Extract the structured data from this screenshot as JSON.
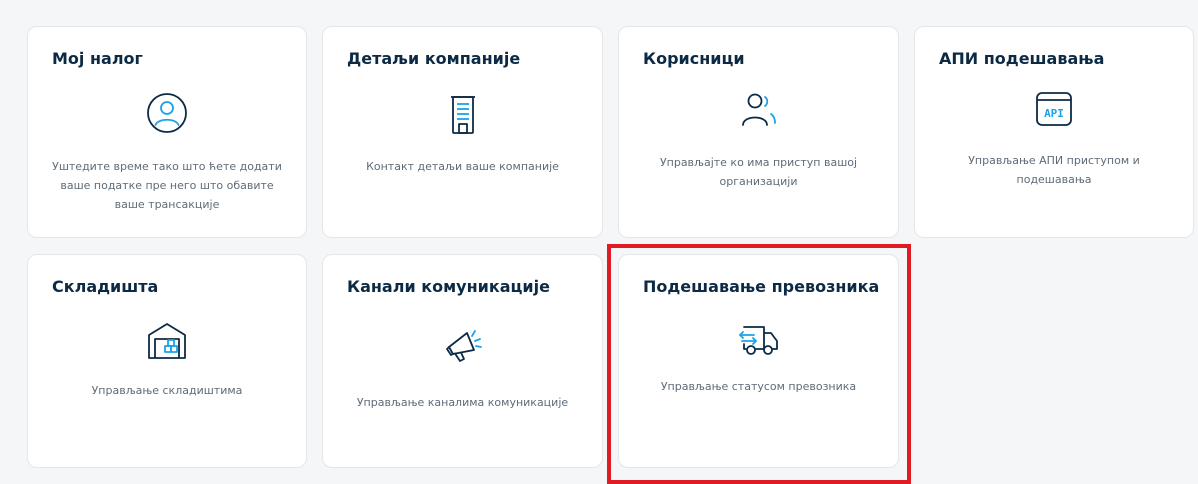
{
  "colors": {
    "page_background": "#f5f6f8",
    "card_background": "#ffffff",
    "title_color": "#0d2a45",
    "icon_dark": "#0d2a45",
    "icon_accent": "#1aa3e8",
    "highlight": "#e01b24"
  },
  "cards": [
    {
      "title": "Мој налог",
      "icon": "user-circle-icon",
      "description": "Уштедите време тако што ћете додати ваше податке пре него што обавите ваше трансакције"
    },
    {
      "title": "Детаљи компаније",
      "icon": "building-icon",
      "description": "Контакт детаљи ваше компаније"
    },
    {
      "title": "Корисници",
      "icon": "users-icon",
      "description": "Управљајте ко има приступ вашој организацији"
    },
    {
      "title": "АПИ подешавања",
      "icon": "api-window-icon",
      "icon_text": "API",
      "description": "Управљање АПИ приступом и подешавања"
    },
    {
      "title": "Складишта",
      "icon": "warehouse-icon",
      "description": "Управљање складиштима"
    },
    {
      "title": "Канали комуникације",
      "icon": "megaphone-icon",
      "description": "Управљање каналима комуникације"
    },
    {
      "title": "Подешавање превозника",
      "icon": "delivery-truck-icon",
      "description": "Управљање статусом превозника",
      "highlighted": true
    }
  ]
}
